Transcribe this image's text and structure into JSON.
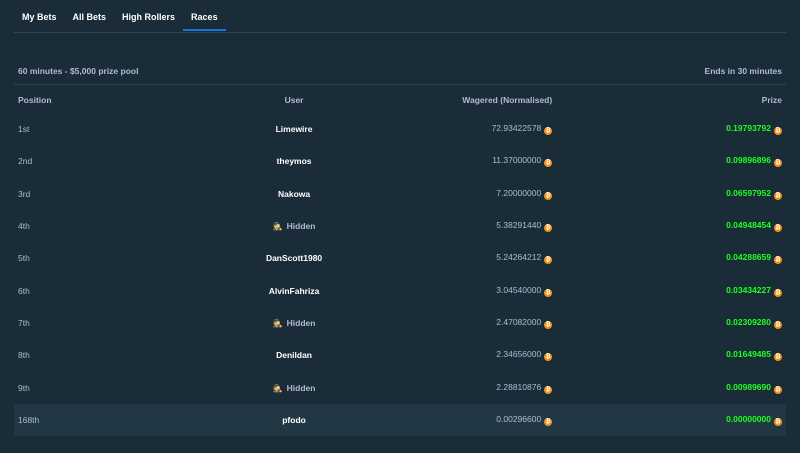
{
  "tabs": [
    {
      "label": "My Bets"
    },
    {
      "label": "All Bets"
    },
    {
      "label": "High Rollers"
    },
    {
      "label": "Races"
    }
  ],
  "race": {
    "description": "60 minutes - $5,000 prize pool",
    "ends": "Ends in 30 minutes"
  },
  "columns": {
    "position": "Position",
    "user": "User",
    "wagered": "Wagered (Normalised)",
    "prize": "Prize"
  },
  "rows": [
    {
      "position": "1st",
      "user": "Limewire",
      "wagered": "72.93422578",
      "prize": "0.19793792"
    },
    {
      "position": "2nd",
      "user": "theymos",
      "wagered": "11.37000000",
      "prize": "0.09896896"
    },
    {
      "position": "3rd",
      "user": "Nakowa",
      "wagered": "7.20000000",
      "prize": "0.06597952"
    },
    {
      "position": "4th",
      "user": "Hidden",
      "wagered": "5.38291440",
      "prize": "0.04948454"
    },
    {
      "position": "5th",
      "user": "DanScott1980",
      "wagered": "5.24264212",
      "prize": "0.04288659"
    },
    {
      "position": "6th",
      "user": "AlvinFahriza",
      "wagered": "3.04540000",
      "prize": "0.03434227"
    },
    {
      "position": "7th",
      "user": "Hidden",
      "wagered": "2.47082000",
      "prize": "0.02309280"
    },
    {
      "position": "8th",
      "user": "Denildan",
      "wagered": "2.34656000",
      "prize": "0.01649485"
    },
    {
      "position": "9th",
      "user": "Hidden",
      "wagered": "2.28810876",
      "prize": "0.00989690"
    },
    {
      "position": "168th",
      "user": "pfodo",
      "wagered": "0.00296600",
      "prize": "0.00000000"
    }
  ],
  "colors": {
    "accent": "#1475e1",
    "prize": "#1fff20",
    "bitcoin": "#f7931a",
    "background": "#1a2c38"
  },
  "icons": {
    "currency": "bitcoin-icon",
    "hidden": "incognito-icon"
  }
}
